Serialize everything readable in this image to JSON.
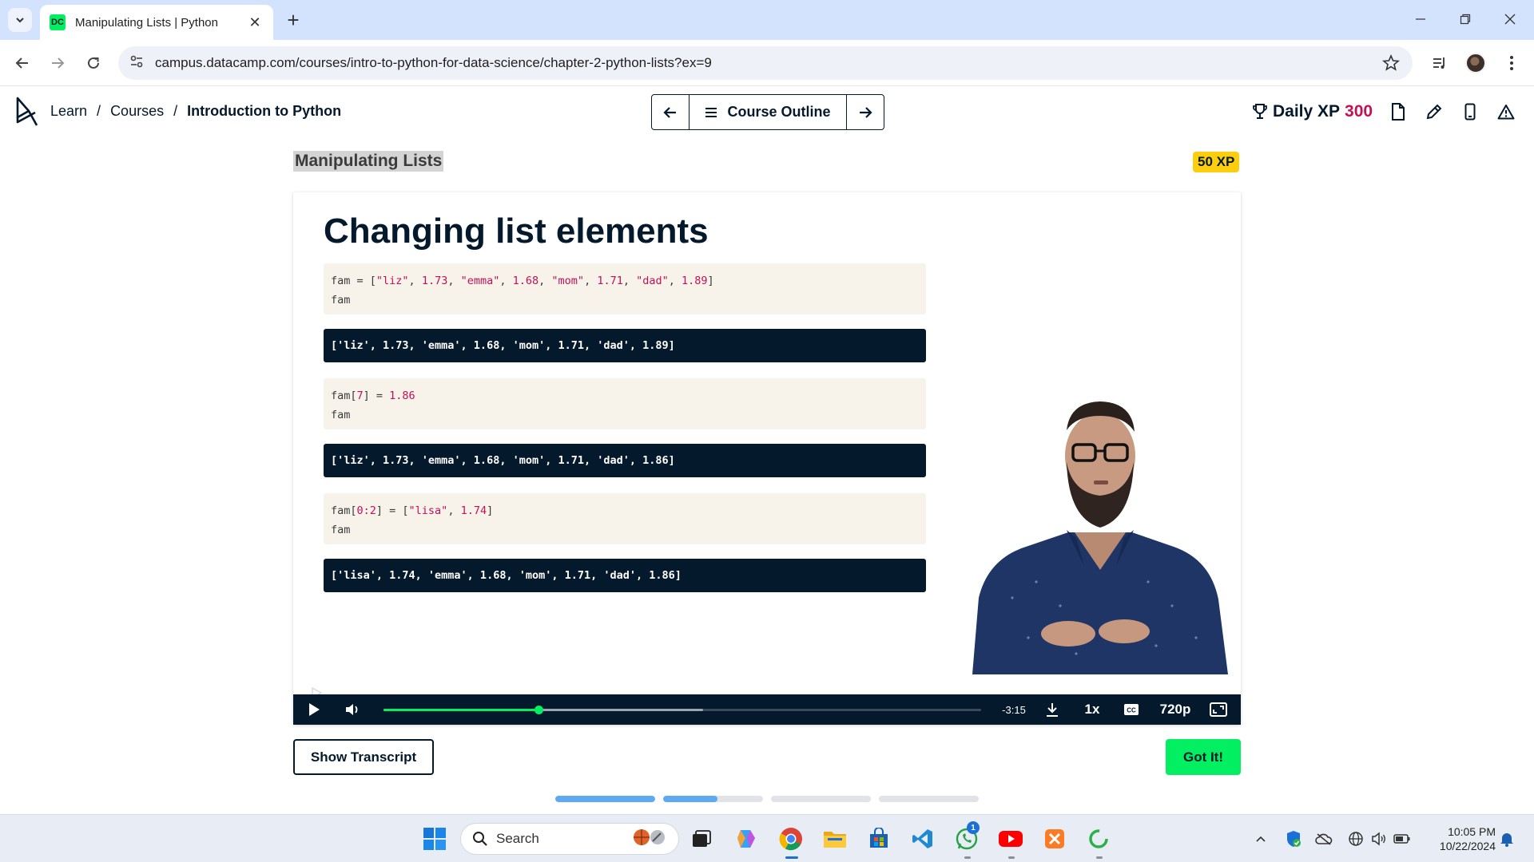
{
  "browser": {
    "tab_title": "Manipulating Lists | Python",
    "url": "campus.datacamp.com/courses/intro-to-python-for-data-science/chapter-2-python-lists?ex=9"
  },
  "header": {
    "breadcrumbs": [
      "Learn",
      "Courses",
      "Introduction to Python"
    ],
    "separator": "/",
    "course_outline_label": "Course Outline",
    "daily_xp_label": "Daily XP",
    "daily_xp_value": "300"
  },
  "exercise": {
    "title": "Manipulating Lists",
    "xp_badge": "50 XP"
  },
  "slide": {
    "title": "Changing list elements",
    "blocks": [
      {
        "in_line1": [
          "fam = [",
          "\"liz\"",
          ", ",
          "1.73",
          ", ",
          "\"emma\"",
          ", ",
          "1.68",
          ", ",
          "\"mom\"",
          ", ",
          "1.71",
          ", ",
          "\"dad\"",
          ", ",
          "1.89",
          "]"
        ],
        "in_line2": "fam",
        "out": "['liz', 1.73, 'emma', 1.68, 'mom', 1.71, 'dad', 1.89]"
      },
      {
        "in_line1": [
          "fam[",
          "7",
          "] = ",
          "1.86"
        ],
        "in_line2": "fam",
        "out": "['liz', 1.73, 'emma', 1.68, 'mom', 1.71, 'dad', 1.86]"
      },
      {
        "in_line1": [
          "fam[",
          "0:2",
          "] = [",
          "\"lisa\"",
          ", ",
          "1.74",
          "]"
        ],
        "in_line2": "fam",
        "out": "['lisa', 1.74, 'emma', 1.68, 'mom', 1.71, 'dad', 1.86]"
      }
    ]
  },
  "player": {
    "time_remaining": "-3:15",
    "speed": "1x",
    "quality": "720p",
    "played_fraction": 0.26,
    "buffered_fraction": 0.535
  },
  "actions": {
    "transcript_label": "Show Transcript",
    "got_it_label": "Got It!"
  },
  "lesson_progress": [
    1.0,
    0.54,
    0.0,
    0.0
  ],
  "taskbar": {
    "search_label": "Search",
    "whatsapp_badge": "1",
    "time": "10:05 PM",
    "date": "10/22/2024"
  },
  "colors": {
    "brand_green": "#03ef62",
    "navy": "#05192d",
    "xp_pink": "#c01254",
    "badge_yellow": "#fcce0d",
    "progress_blue": "#5fa8f2"
  },
  "icons": [
    "chevron-down-icon",
    "close-icon",
    "plus-icon",
    "minimize-icon",
    "restore-icon",
    "back-icon",
    "forward-icon",
    "reload-icon",
    "site-settings-icon",
    "star-icon",
    "media-icon",
    "more-icon",
    "datacamp-logo",
    "arrow-left-icon",
    "menu-icon",
    "arrow-right-icon",
    "trophy-icon",
    "document-icon",
    "pencil-icon",
    "mobile-icon",
    "warning-icon",
    "play-icon",
    "volume-icon",
    "download-icon",
    "captions-icon",
    "fullscreen-icon",
    "windows-icon",
    "search-icon"
  ]
}
